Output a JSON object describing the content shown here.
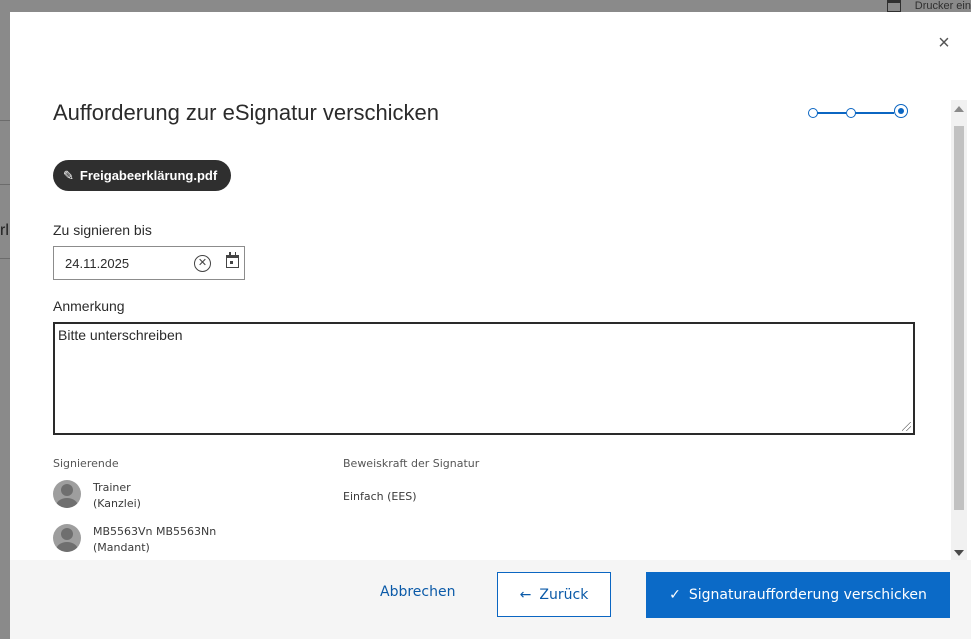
{
  "background": {
    "top_right_text": "Drucker ein",
    "left_letter": "rl"
  },
  "dialog": {
    "title": "Aufforderung zur eSignatur verschicken",
    "close_symbol": "×",
    "steps_total": 3,
    "active_step": 3,
    "file_chip": {
      "icon": "pen-icon",
      "label": "Freigabeerklärung.pdf"
    },
    "due_date": {
      "label": "Zu signieren bis",
      "value": "24.11.2025"
    },
    "note": {
      "label": "Anmerkung",
      "value": "Bitte unterschreiben"
    },
    "signers": {
      "label": "Signierende",
      "items": [
        {
          "name": "Trainer",
          "role": "(Kanzlei)"
        },
        {
          "name": "MB5563Vn MB5563Nn",
          "role": "(Mandant)"
        }
      ]
    },
    "signature_strength": {
      "label": "Beweiskraft der Signatur",
      "value": "Einfach (EES)"
    }
  },
  "footer": {
    "cancel_label": "Abbrechen",
    "back_label": "Zurück",
    "back_icon": "←",
    "send_label": "Signaturaufforderung verschicken",
    "send_icon": "✓"
  },
  "colors": {
    "accent": "#0b6ac7",
    "chip_bg": "#2f2f2f",
    "footer_bg": "#f5f5f5"
  }
}
